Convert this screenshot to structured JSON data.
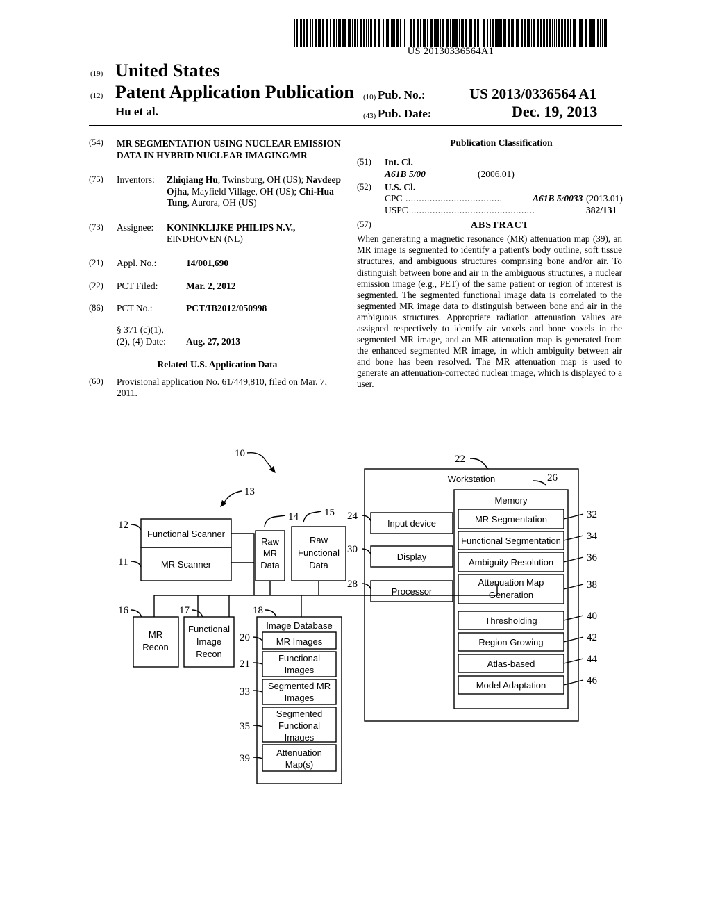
{
  "header": {
    "barcode_number": "US 20130336564A1",
    "code_19": "(19)",
    "country": "United States",
    "code_12": "(12)",
    "doc_type": "Patent Application Publication",
    "authors": "Hu et al.",
    "code_10": "(10)",
    "pub_no_label": "Pub. No.:",
    "pub_no_value": "US 2013/0336564 A1",
    "code_43": "(43)",
    "pub_date_label": "Pub. Date:",
    "pub_date_value": "Dec. 19, 2013"
  },
  "left_column": {
    "title_num": "(54)",
    "title": "MR SEGMENTATION USING NUCLEAR EMISSION DATA IN HYBRID NUCLEAR IMAGING/MR",
    "inventors_num": "(75)",
    "inventors_label": "Inventors:",
    "inventors": [
      {
        "name": "Zhiqiang Hu",
        "rest": ", Twinsburg, OH (US);"
      },
      {
        "name": "Navdeep Ojha",
        "rest": ", Mayfield Village, OH"
      },
      {
        "name": "Chi-Hua Tung",
        "prefix": "(US); ",
        "rest": ", Aurora, OH (US)"
      }
    ],
    "assignee_num": "(73)",
    "assignee_label": "Assignee:",
    "assignee_name": "KONINKLIJKE PHILIPS N.V.,",
    "assignee_city": "EINDHOVEN (NL)",
    "appl_num": "(21)",
    "appl_label": "Appl. No.:",
    "appl_value": "14/001,690",
    "pct_filed_num": "(22)",
    "pct_filed_label": "PCT Filed:",
    "pct_filed_value": "Mar. 2, 2012",
    "pct_no_num": "(86)",
    "pct_no_label": "PCT No.:",
    "pct_no_value": "PCT/IB2012/050998",
    "sec371_line1": "§ 371 (c)(1),",
    "sec371_line2": "(2), (4) Date:",
    "sec371_value": "Aug. 27, 2013",
    "related_heading": "Related U.S. Application Data",
    "provisional_num": "(60)",
    "provisional_text": "Provisional application No. 61/449,810, filed on Mar. 7, 2011."
  },
  "right_column": {
    "pub_class_heading": "Publication Classification",
    "int_cl_num": "(51)",
    "int_cl_label": "Int. Cl.",
    "int_cl_code": "A61B 5/00",
    "int_cl_version": "(2006.01)",
    "us_cl_num": "(52)",
    "us_cl_label": "U.S. Cl.",
    "cpc_label": "CPC",
    "cpc_dots": "....................................",
    "cpc_code": "A61B 5/0033",
    "cpc_version": "(2013.01)",
    "uspc_label": "USPC",
    "uspc_dots": "..............................................",
    "uspc_code": "382/131",
    "abstract_num": "(57)",
    "abstract_heading": "ABSTRACT",
    "abstract_text": "When generating a magnetic resonance (MR) attenuation map (39), an MR image is segmented to identify a patient's body outline, soft tissue structures, and ambiguous structures comprising bone and/or air. To distinguish between bone and air in the ambiguous structures, a nuclear emission image (e.g., PET) of the same patient or region of interest is segmented. The segmented functional image data is correlated to the segmented MR image data to distinguish between bone and air in the ambiguous structures. Appropriate radiation attenuation values are assigned respectively to identify air voxels and bone voxels in the segmented MR image, and an MR attenuation map is generated from the enhanced segmented MR image, in which ambiguity between air and bone has been resolved. The MR attenuation map is used to generate an attenuation-corrected nuclear image, which is displayed to a user."
  },
  "figure": {
    "system_ref": "10",
    "boxes": {
      "functional_scanner": {
        "ref": "12",
        "label": "Functional Scanner"
      },
      "mr_scanner": {
        "ref": "11",
        "label": "MR Scanner"
      },
      "scanner_group": {
        "ref": "13"
      },
      "raw_mr_data": {
        "ref": "14",
        "label": "Raw\nMR\nData",
        "lines": [
          "Raw",
          "MR",
          "Data"
        ]
      },
      "raw_functional_data": {
        "ref": "15",
        "lines": [
          "Raw",
          "Functional",
          "Data"
        ]
      },
      "mr_recon": {
        "ref": "16",
        "lines": [
          "MR",
          "Recon"
        ]
      },
      "functional_image_recon": {
        "ref": "17",
        "lines": [
          "Functional",
          "Image",
          "Recon"
        ]
      },
      "image_database": {
        "ref": "18",
        "label": "Image Database"
      },
      "mr_images": {
        "ref": "20",
        "lines": [
          "MR Images"
        ]
      },
      "functional_images": {
        "ref": "21",
        "lines": [
          "Functional",
          "Images"
        ]
      },
      "segmented_mr_images": {
        "ref": "33",
        "lines": [
          "Segmented  MR",
          "Images"
        ]
      },
      "segmented_functional_images": {
        "ref": "35",
        "lines": [
          "Segmented",
          "Functional",
          "Images"
        ]
      },
      "attenuation_maps": {
        "ref": "39",
        "lines": [
          "Attenuation",
          "Map(s)"
        ]
      },
      "workstation": {
        "ref": "22",
        "label": "Workstation"
      },
      "input_device": {
        "ref": "24",
        "label": "Input device"
      },
      "display": {
        "ref": "30",
        "label": "Display"
      },
      "processor": {
        "ref": "28",
        "label": "Processor"
      },
      "memory": {
        "ref": "26",
        "label": "Memory"
      },
      "mr_segmentation": {
        "ref": "32",
        "label": "MR Segmentation"
      },
      "functional_segmentation": {
        "ref": "34",
        "label": "Functional Segmentation"
      },
      "ambiguity_resolution": {
        "ref": "36",
        "label": "Ambiguity Resolution"
      },
      "attenuation_map_generation": {
        "ref": "38",
        "lines": [
          "Attenuation Map",
          "Generation"
        ]
      },
      "thresholding": {
        "ref": "40",
        "label": "Thresholding"
      },
      "region_growing": {
        "ref": "42",
        "label": "Region Growing"
      },
      "atlas_based": {
        "ref": "44",
        "label": "Atlas-based"
      },
      "model_adaptation": {
        "ref": "46",
        "label": "Model Adaptation"
      }
    }
  }
}
